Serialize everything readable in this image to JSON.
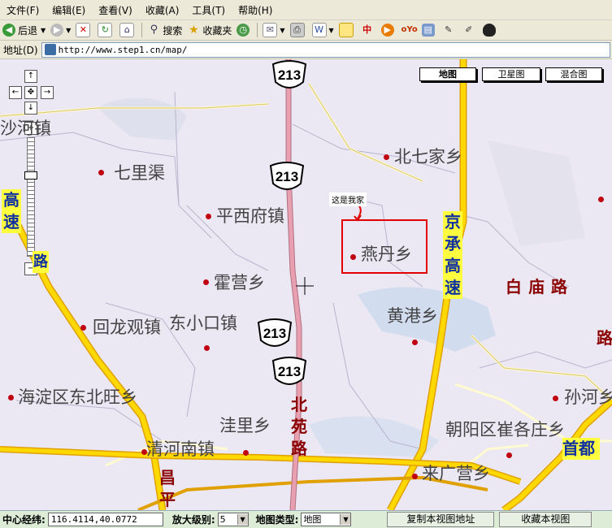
{
  "menu": [
    "文件(F)",
    "编辑(E)",
    "查看(V)",
    "收藏(A)",
    "工具(T)",
    "帮助(H)"
  ],
  "toolbar": {
    "back": "后退",
    "search": "搜索",
    "favorites": "收藏夹"
  },
  "address": {
    "label": "地址(D)",
    "url": "http://www.step1.cn/map/"
  },
  "map_types": {
    "map": "地图",
    "satellite": "卫星图",
    "hybrid": "混合图"
  },
  "marker": {
    "label": "这是我家"
  },
  "places": {
    "shahe": "沙河镇",
    "qiliqu": "七里渠",
    "beiqijia": "北七家乡",
    "pingxifu": "平西府镇",
    "yandan": "燕丹乡",
    "huoying": "霍营乡",
    "huilongguan": "回龙观镇",
    "dongxiaokou": "东小口镇",
    "huanggang": "黄港乡",
    "haidian_dongbeiwang": "海淀区东北旺乡",
    "wali": "洼里乡",
    "qinghe": "清河南镇",
    "chaoyang_cuigezhuang": "朝阳区崔各庄乡",
    "laiguangying": "来广营乡",
    "sunhe": "孙河乡"
  },
  "roads": {
    "jingcheng": [
      "京",
      "承",
      "高",
      "速"
    ],
    "baimiao": [
      "白",
      "庙",
      "路"
    ],
    "beiyuan": [
      "北",
      "苑",
      "路"
    ],
    "changping": [
      "昌",
      "平"
    ],
    "shoudu": [
      "首",
      "都"
    ],
    "gaosu_left": [
      "高",
      "速"
    ],
    "lu_right": "路",
    "lu_left": "路"
  },
  "shields": {
    "route": "213"
  },
  "status": {
    "center_label": "中心经纬:",
    "center_value": "116.4114,40.0772",
    "zoom_label": "放大级别:",
    "zoom_value": "5",
    "type_label": "地图类型:",
    "type_value": "地图",
    "copy_button": "复制本视图地址",
    "save_button": "收藏本视图"
  },
  "colors": {
    "highway": "#ffd800",
    "highway_edge": "#e0a000",
    "route_213": "#e8a0b0",
    "marker_box": "#e00000",
    "map_bg": "#ebe8f4"
  }
}
